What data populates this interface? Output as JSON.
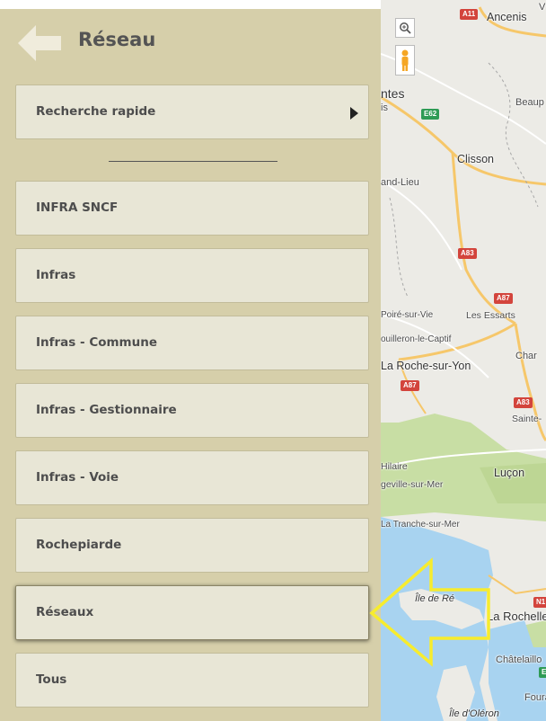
{
  "header": {
    "title": "Réseau",
    "back_icon": "back-arrow-icon"
  },
  "menu": {
    "quick_search": {
      "label": "Recherche rapide",
      "icon": "chevron-right-icon"
    },
    "items": [
      {
        "label": "INFRA SNCF"
      },
      {
        "label": "Infras"
      },
      {
        "label": "Infras - Commune"
      },
      {
        "label": "Infras - Gestionnaire"
      },
      {
        "label": "Infras - Voie"
      },
      {
        "label": "Rochepiarde"
      },
      {
        "label": "Réseaux",
        "active": true
      },
      {
        "label": "Tous"
      }
    ]
  },
  "map": {
    "controls": [
      "zoom-icon",
      "pegman-icon"
    ],
    "labels": {
      "ancenis": "Ancenis",
      "nantes": "ntes",
      "is": "is",
      "beaup": "Beaup",
      "clisson": "Clisson",
      "grandlieu": "and-Lieu",
      "poire": "Poiré-sur-Vie",
      "essarts": "Les Essarts",
      "poiron": "ouilleron-le-Captif",
      "laroche": "La Roche-sur-Yon",
      "char": "Char",
      "sainte": "Sainte-",
      "hilaire": "Hilaire",
      "lucon": "Luçon",
      "angeville": "geville-sur-Mer",
      "tranche": "La Tranche-sur-Mer",
      "ilere": "Île de Ré",
      "rochelle": "La Rochelle",
      "chatelaillon": "Châtelaillo",
      "foura": "Foura",
      "oleron": "Île d'Oléron",
      "v": "V"
    },
    "roads": {
      "a11": "A11",
      "e62": "E62",
      "a83_1": "A83",
      "a87_1": "A87",
      "a87_2": "A87",
      "a83_2": "A83",
      "n1": "N1",
      "e": "E"
    },
    "colors": {
      "land": "#ecebe6",
      "forest": "#c8dea4",
      "water": "#a8d3f0",
      "highway": "#f6c76a",
      "annotation": "#f7ec2e"
    }
  }
}
